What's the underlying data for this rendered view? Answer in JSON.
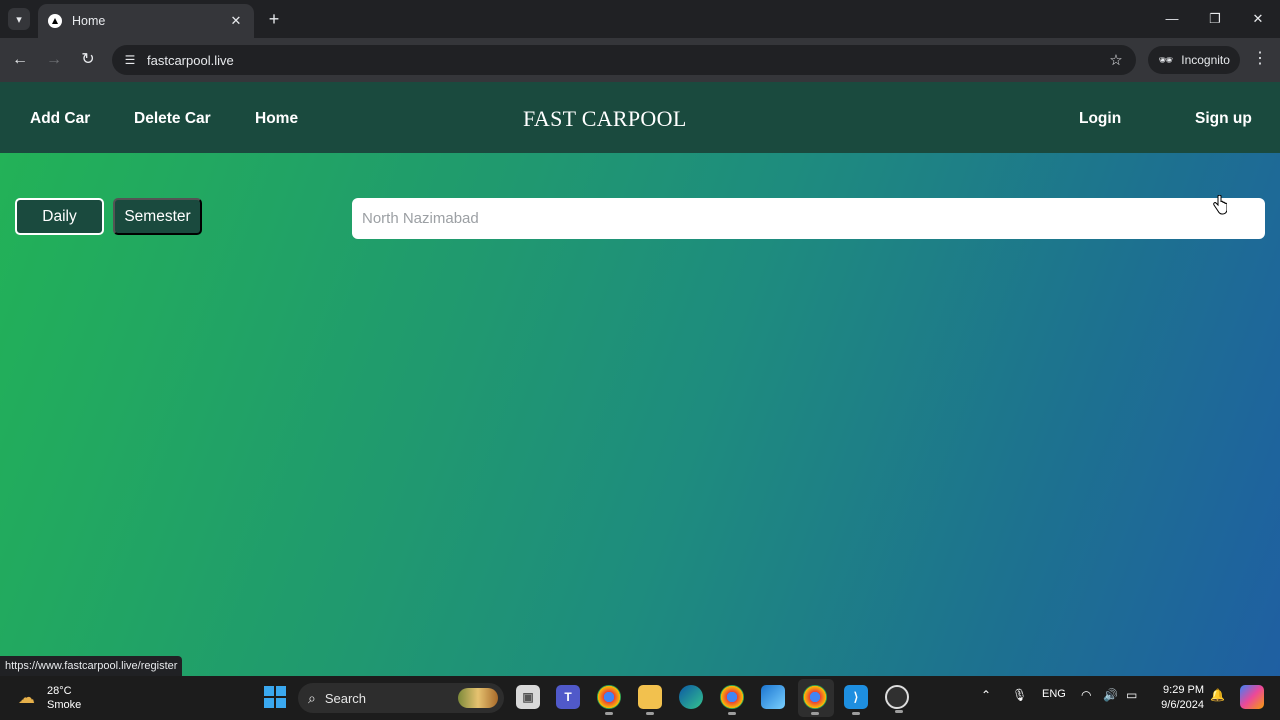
{
  "browser": {
    "tab_title": "Home",
    "url": "fastcarpool.live",
    "incognito_label": "Incognito",
    "status_url": "https://www.fastcarpool.live/register"
  },
  "site": {
    "nav_left": [
      "Add Car",
      "Delete Car",
      "Home"
    ],
    "brand": "FAST CARPOOL",
    "nav_right": [
      "Login",
      "Sign up"
    ],
    "mode_buttons": [
      "Daily",
      "Semester"
    ],
    "active_mode": "Daily",
    "search_placeholder": "North Nazimabad",
    "colors": {
      "nav_bg": "#1a4a3e",
      "gradient_start": "#23b356",
      "gradient_end": "#1f5fa2"
    }
  },
  "taskbar": {
    "weather_temp": "28°C",
    "weather_desc": "Smoke",
    "search_label": "Search",
    "language": "ENG",
    "time": "9:29 PM",
    "date": "9/6/2024",
    "apps": [
      "file-explorer-icon",
      "teams-icon",
      "chrome-icon",
      "folder-icon",
      "edge-icon",
      "chrome-icon",
      "photos-icon",
      "chrome-icon",
      "vscode-icon",
      "obs-icon"
    ]
  }
}
